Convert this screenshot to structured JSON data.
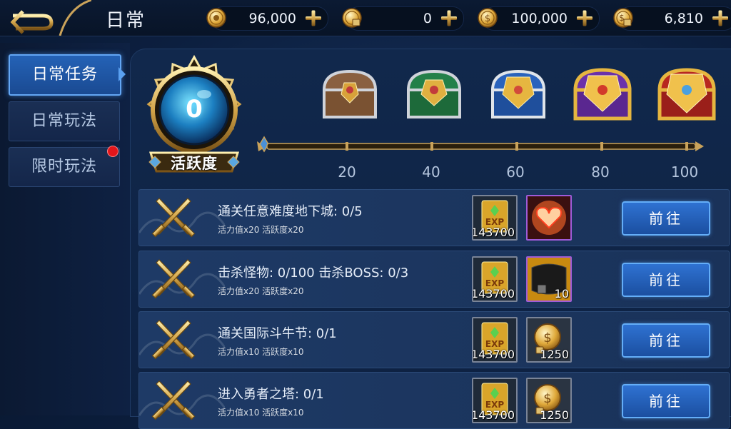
{
  "header": {
    "title": "日常",
    "resources": [
      {
        "icon": "gold-coin-icon",
        "value": "96,000"
      },
      {
        "icon": "locked-gold-coin-icon",
        "value": "0"
      },
      {
        "icon": "silver-coin-icon",
        "value": "100,000"
      },
      {
        "icon": "locked-silver-coin-icon",
        "value": "6,810"
      }
    ]
  },
  "sidebar": {
    "items": [
      {
        "label": "日常任务",
        "active": true
      },
      {
        "label": "日常玩法",
        "active": false
      },
      {
        "label": "限时玩法",
        "active": false,
        "badge": true
      }
    ]
  },
  "activity": {
    "value": "0",
    "label": "活跃度",
    "milestones": [
      "20",
      "40",
      "60",
      "80",
      "100"
    ],
    "progress": 0,
    "chests": [
      "silver-chest-icon",
      "green-chest-icon",
      "blue-chest-icon",
      "purple-chest-icon",
      "red-chest-icon"
    ]
  },
  "tasks": [
    {
      "title": "通关任意难度地下城: 0/5",
      "reward": "活力值x20   活跃度x20",
      "items": [
        {
          "icon": "exp-book-icon",
          "count": "143700"
        },
        {
          "icon": "heart-hands-icon",
          "count": ""
        }
      ],
      "button": "前往"
    },
    {
      "title": "击杀怪物: 0/100   击杀BOSS: 0/3",
      "reward": "活力值x20   活跃度x20",
      "items": [
        {
          "icon": "exp-book-icon",
          "count": "143700"
        },
        {
          "icon": "locked-armor-icon",
          "count": "10"
        }
      ],
      "button": "前往"
    },
    {
      "title": "通关国际斗牛节: 0/1",
      "reward": "活力值x10   活跃度x10",
      "items": [
        {
          "icon": "exp-book-icon",
          "count": "143700"
        },
        {
          "icon": "locked-silver-coin-icon",
          "count": "1250"
        }
      ],
      "button": "前往"
    },
    {
      "title": "进入勇者之塔: 0/1",
      "reward": "活力值x10   活跃度x10",
      "items": [
        {
          "icon": "exp-book-icon",
          "count": "143700"
        },
        {
          "icon": "locked-silver-coin-icon",
          "count": "1250"
        }
      ],
      "button": "前往"
    }
  ],
  "colors": {
    "accent": "#2f72d2",
    "badge": "#e3161b",
    "gold": "#c9a25a"
  }
}
